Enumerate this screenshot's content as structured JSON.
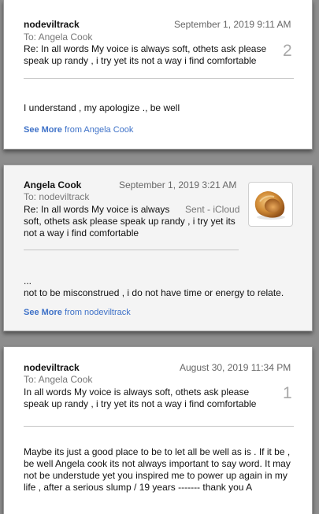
{
  "messages": [
    {
      "sender": "nodeviltrack",
      "date": "September 1, 2019  9:11 AM",
      "to": "To:  Angela Cook",
      "subject_line1": "Re: In all words My voice is always soft, othets ask please",
      "subject_line2": "speak up randy , i try yet its not a way i find comfortable",
      "count": "2",
      "body_line1": "I understand , my apologize ., be well",
      "see_more_prefix": "See More",
      "see_more_suffix": " from Angela Cook"
    },
    {
      "sender": "Angela Cook",
      "date": "September 1, 2019  3:21 AM",
      "to": "To:  nodeviltrack",
      "subject_line1": "Re: In all words My voice is always",
      "subject_line2": "soft, othets ask please speak up randy , i try yet its",
      "subject_line3": "not a way i find comfortable",
      "sent_label": "Sent - iCloud",
      "thumbnail_icon": "fortune-cookie-icon",
      "body_line1": "...",
      "body_line2": "not to be misconstrued , i do not have time or energy to relate.",
      "see_more_prefix": "See More",
      "see_more_suffix": " from nodeviltrack"
    },
    {
      "sender": "nodeviltrack",
      "date": "August 30, 2019  11:34 PM",
      "to": "To:  Angela Cook",
      "subject_line1": "In all words My voice is always soft, othets ask please",
      "subject_line2": "speak up randy , i try yet its not a way i find comfortable",
      "count": "1",
      "body_line1": "Maybe its just a good place to be to let all be well as is . If it be ,",
      "body_line2": "be well Angela cook its not always important to say word. It may",
      "body_line3": "not be understude yet you inspired me to power up again in my",
      "body_line4": "life , after a serious slump / 19 years ------- thank you  A"
    }
  ],
  "colors": {
    "background": "#8d8d8d",
    "link": "#3f72c8",
    "card_white": "#ffffff",
    "card_gray": "#f4f4f4"
  }
}
